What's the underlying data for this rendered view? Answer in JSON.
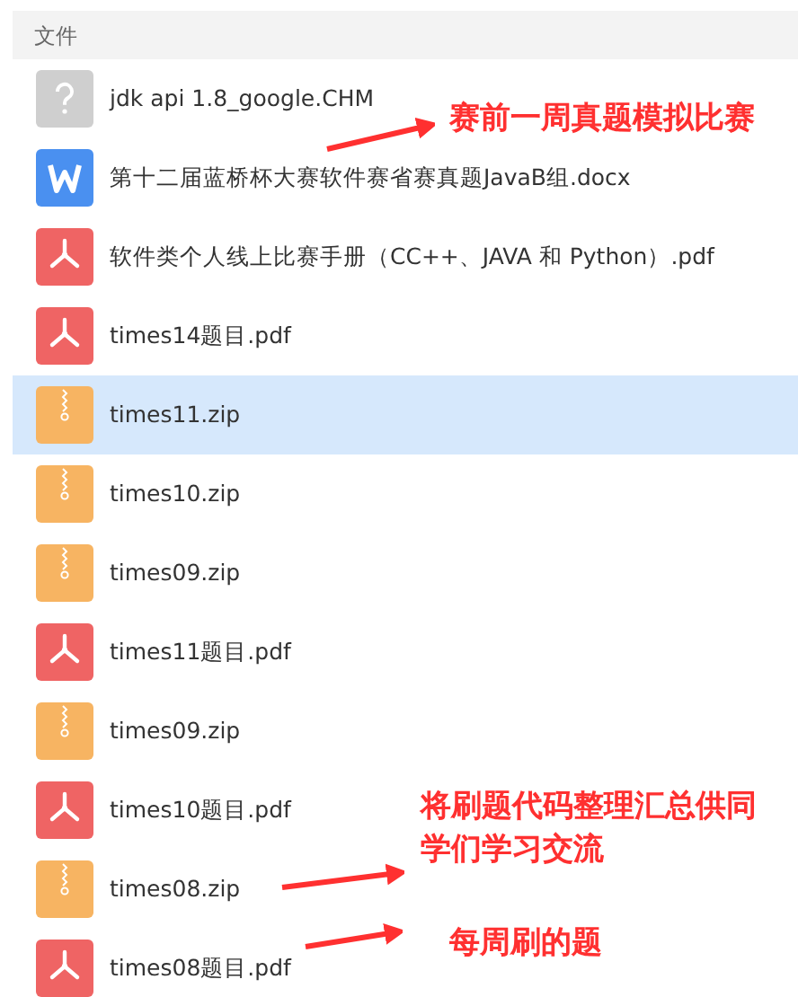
{
  "header": "文件",
  "files": [
    {
      "kind": "unknown",
      "name": "jdk api 1.8_google.CHM",
      "selected": false
    },
    {
      "kind": "word",
      "name": "第十二届蓝桥杯大赛软件赛省赛真题JavaB组.docx",
      "selected": false
    },
    {
      "kind": "pdf",
      "name": "软件类个人线上比赛手册（CC++、JAVA 和 Python）.pdf",
      "selected": false
    },
    {
      "kind": "pdf",
      "name": "times14题目.pdf",
      "selected": false
    },
    {
      "kind": "zip",
      "name": "times11.zip",
      "selected": true
    },
    {
      "kind": "zip",
      "name": "times10.zip",
      "selected": false
    },
    {
      "kind": "zip",
      "name": "times09.zip",
      "selected": false
    },
    {
      "kind": "pdf",
      "name": "times11题目.pdf",
      "selected": false
    },
    {
      "kind": "zip",
      "name": "times09.zip",
      "selected": false
    },
    {
      "kind": "pdf",
      "name": "times10题目.pdf",
      "selected": false
    },
    {
      "kind": "zip",
      "name": "times08.zip",
      "selected": false
    },
    {
      "kind": "pdf",
      "name": "times08题目.pdf",
      "selected": false
    }
  ],
  "annotations": [
    "赛前一周真题模拟比赛",
    "将刷题代码整理汇总供同学们学习交流",
    "每周刷的题"
  ]
}
